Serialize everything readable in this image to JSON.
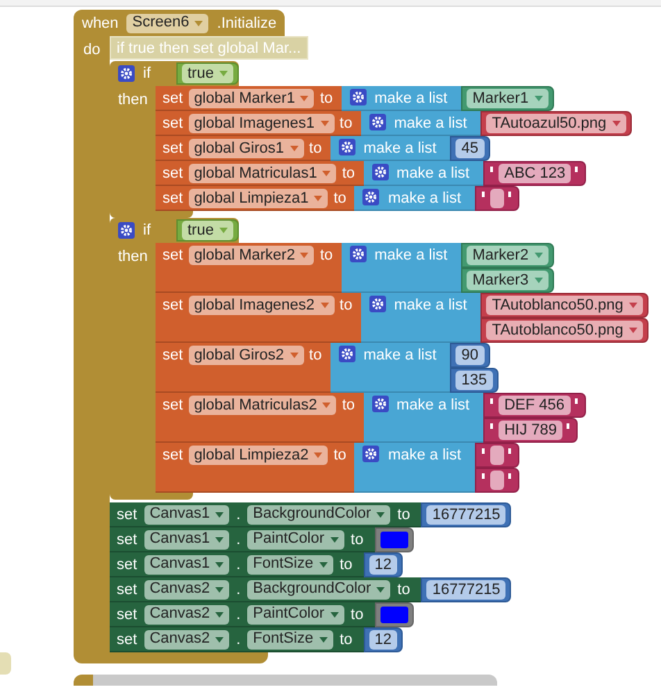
{
  "event_block": {
    "when": "when",
    "component": "Screen6",
    "event": ".Initialize",
    "do": "do"
  },
  "collapsed_block": {
    "label": "if true then set global Mar..."
  },
  "if_blocks": [
    {
      "if_label": "if",
      "condition": "true",
      "then_label": "then",
      "statements": [
        {
          "set_label": "set",
          "variable": "global Marker1",
          "to_label": "to",
          "list_label": "make a list",
          "items": [
            {
              "kind": "component",
              "text": "Marker1"
            }
          ]
        },
        {
          "set_label": "set",
          "variable": "global Imagenes1",
          "to_label": "to",
          "list_label": "make a list",
          "items": [
            {
              "kind": "asset",
              "text": "TAutoazul50.png"
            }
          ]
        },
        {
          "set_label": "set",
          "variable": "global Giros1",
          "to_label": "to",
          "list_label": "make a list",
          "items": [
            {
              "kind": "number",
              "text": "45"
            }
          ]
        },
        {
          "set_label": "set",
          "variable": "global Matriculas1",
          "to_label": "to",
          "list_label": "make a list",
          "items": [
            {
              "kind": "text",
              "text": "ABC 123"
            }
          ]
        },
        {
          "set_label": "set",
          "variable": "global Limpieza1",
          "to_label": "to",
          "list_label": "make a list",
          "items": [
            {
              "kind": "empty_text"
            }
          ]
        }
      ]
    },
    {
      "if_label": "if",
      "condition": "true",
      "then_label": "then",
      "statements": [
        {
          "set_label": "set",
          "variable": "global Marker2",
          "to_label": "to",
          "list_label": "make a list",
          "items": [
            {
              "kind": "component",
              "text": "Marker2"
            },
            {
              "kind": "component",
              "text": "Marker3"
            }
          ]
        },
        {
          "set_label": "set",
          "variable": "global Imagenes2",
          "to_label": "to",
          "list_label": "make a list",
          "items": [
            {
              "kind": "asset",
              "text": "TAutoblanco50.png"
            },
            {
              "kind": "asset",
              "text": "TAutoblanco50.png"
            }
          ]
        },
        {
          "set_label": "set",
          "variable": "global Giros2",
          "to_label": "to",
          "list_label": "make a list",
          "items": [
            {
              "kind": "number",
              "text": "90"
            },
            {
              "kind": "number",
              "text": "135"
            }
          ]
        },
        {
          "set_label": "set",
          "variable": "global Matriculas2",
          "to_label": "to",
          "list_label": "make a list",
          "items": [
            {
              "kind": "text",
              "text": "DEF 456"
            },
            {
              "kind": "text",
              "text": "HIJ 789"
            }
          ]
        },
        {
          "set_label": "set",
          "variable": "global Limpieza2",
          "to_label": "to",
          "list_label": "make a list",
          "items": [
            {
              "kind": "empty_text"
            },
            {
              "kind": "empty_text"
            }
          ]
        }
      ]
    }
  ],
  "property_setters": [
    {
      "set_label": "set",
      "component": "Canvas1",
      "dot": ".",
      "property": "BackgroundColor",
      "to_label": "to",
      "value": {
        "kind": "number",
        "text": "16777215"
      }
    },
    {
      "set_label": "set",
      "component": "Canvas1",
      "dot": ".",
      "property": "PaintColor",
      "to_label": "to",
      "value": {
        "kind": "color",
        "color": "#0000ff"
      }
    },
    {
      "set_label": "set",
      "component": "Canvas1",
      "dot": ".",
      "property": "FontSize",
      "to_label": "to",
      "value": {
        "kind": "number",
        "text": "12"
      }
    },
    {
      "set_label": "set",
      "component": "Canvas2",
      "dot": ".",
      "property": "BackgroundColor",
      "to_label": "to",
      "value": {
        "kind": "number",
        "text": "16777215"
      }
    },
    {
      "set_label": "set",
      "component": "Canvas2",
      "dot": ".",
      "property": "PaintColor",
      "to_label": "to",
      "value": {
        "kind": "color",
        "color": "#0000ff"
      }
    },
    {
      "set_label": "set",
      "component": "Canvas2",
      "dot": ".",
      "property": "FontSize",
      "to_label": "to",
      "value": {
        "kind": "number",
        "text": "12"
      }
    }
  ]
}
